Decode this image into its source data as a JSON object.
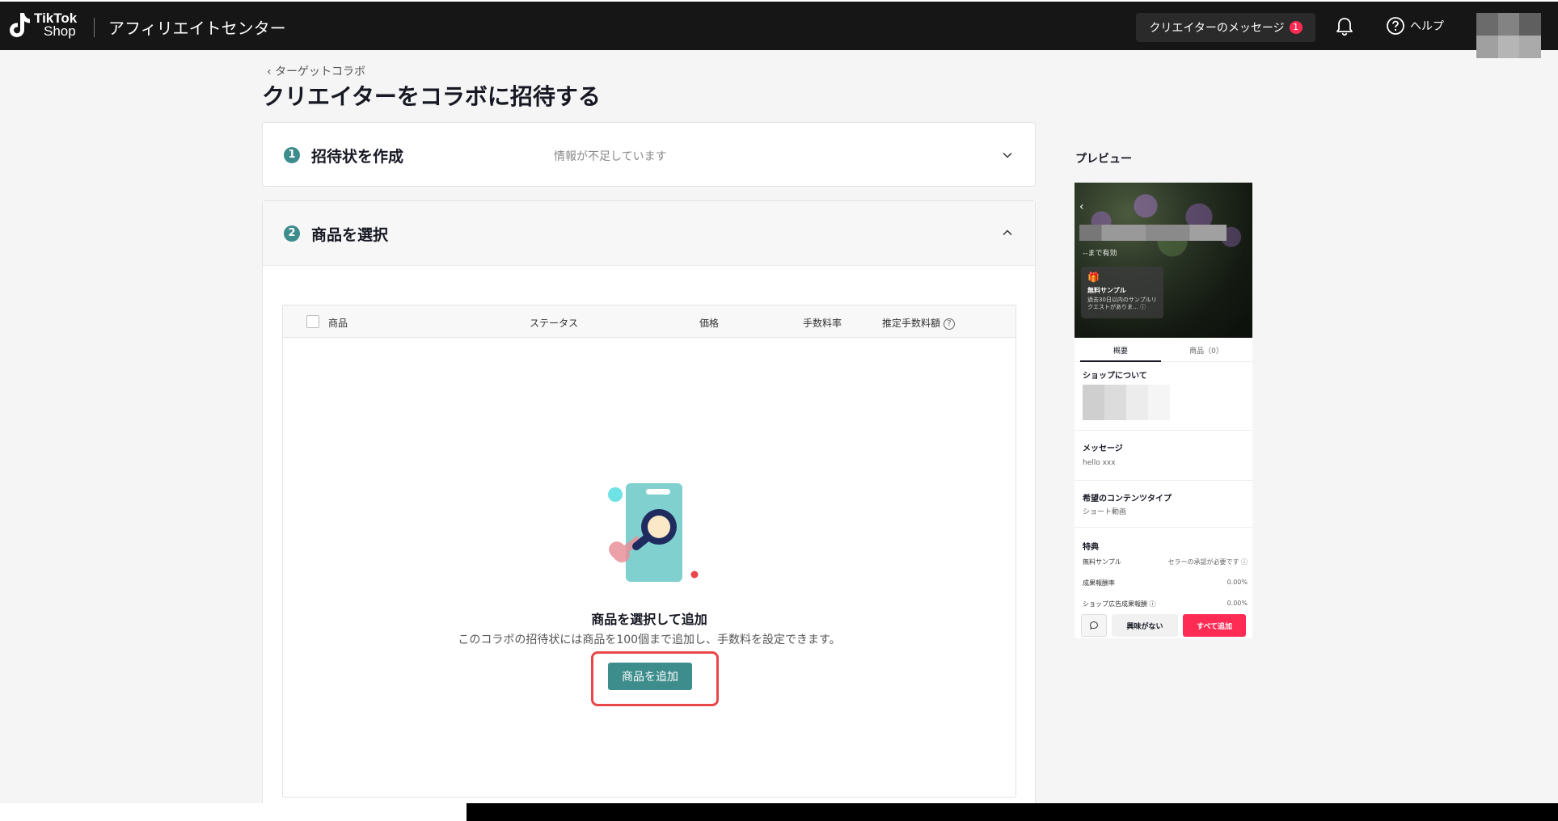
{
  "header": {
    "logo_line1": "TikTok",
    "logo_line2": "Shop",
    "app_title": "アフィリエイトセンター",
    "messages_label": "クリエイターのメッセージ",
    "messages_count": "1",
    "help_label": "ヘルプ"
  },
  "breadcrumb": {
    "back_label": "ターゲットコラボ"
  },
  "page": {
    "title": "クリエイターをコラボに招待する"
  },
  "step1": {
    "number": "1",
    "title": "招待状を作成",
    "hint": "情報が不足しています"
  },
  "step2": {
    "number": "2",
    "title": "商品を選択"
  },
  "table": {
    "columns": [
      "商品",
      "ステータス",
      "価格",
      "手数料率",
      "推定手数料額"
    ],
    "empty_title": "商品を選択して追加",
    "empty_desc": "このコラボの招待状には商品を100個まで追加し、手数料を設定できます。",
    "add_button": "商品を追加"
  },
  "preview": {
    "label": "プレビュー",
    "valid_until": "--まで有効",
    "sample_title": "無料サンプル",
    "sample_desc": "過去30日以内のサンプルリクエストがありま… ⓘ",
    "tabs": [
      "概要",
      "商品（0）"
    ],
    "shop_section": "ショップについて",
    "message_section": "メッセージ",
    "message_text": "hello xxx",
    "content_section": "希望のコンテンツタイプ",
    "content_text": "ショート動画",
    "benefits_section": "特典",
    "benefits": [
      {
        "label": "無料サンプル",
        "value": "セラーの承認が必要です ⓘ"
      },
      {
        "label": "成果報酬率",
        "value": "0.00%"
      },
      {
        "label": "ショップ広告成果報酬 ⓘ",
        "value": "0.00%"
      }
    ],
    "not_interested": "興味がない",
    "add_all": "すべて追加"
  },
  "colors": {
    "accent": "#3d8d8c",
    "brand": "#fe2c55",
    "highlight": "#e8474a"
  }
}
